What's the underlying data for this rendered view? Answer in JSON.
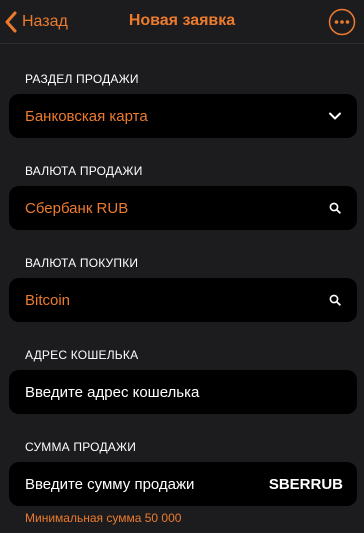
{
  "nav": {
    "back_label": "Назад",
    "title": "Новая заявка",
    "more_icon": "more-icon"
  },
  "sections": {
    "sale_section": {
      "label": "РАЗДЕЛ ПРОДАЖИ",
      "value": "Банковская карта",
      "icon": "chevron-down-icon"
    },
    "sale_currency": {
      "label": "ВАЛЮТА ПРОДАЖИ",
      "value": "Сбербанк RUB",
      "icon": "search-icon"
    },
    "buy_currency": {
      "label": "ВАЛЮТА ПОКУПКИ",
      "value": "Bitcoin",
      "icon": "search-icon"
    },
    "wallet_address": {
      "label": "АДРЕС КОШЕЛЬКА",
      "placeholder": "Введите адрес кошелька"
    },
    "sale_amount": {
      "label": "СУММА ПРОДАЖИ",
      "placeholder": "Введите сумму продажи",
      "suffix": "SBERRUB",
      "hint": "Минимальная сумма 50 000"
    }
  },
  "colors": {
    "accent": "#ec7b2e",
    "background": "#1c1c1e",
    "field_background": "#000000",
    "text": "#ffffff"
  }
}
